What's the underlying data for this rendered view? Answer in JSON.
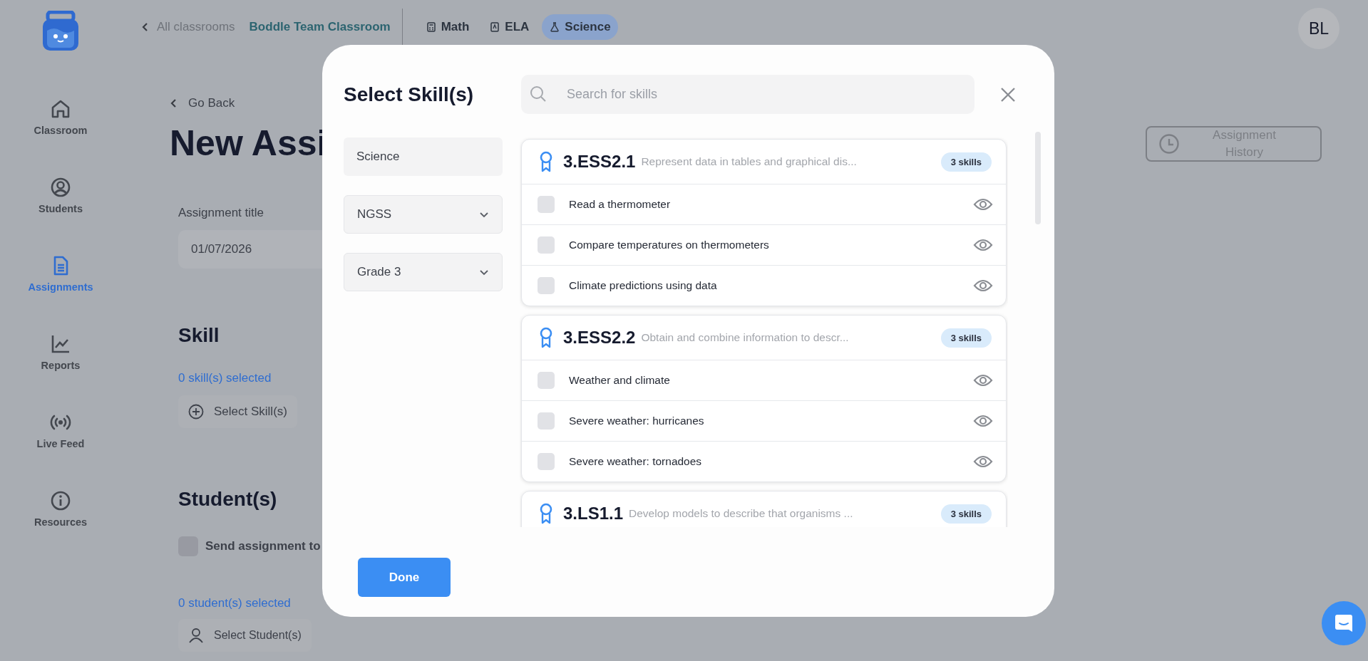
{
  "topbar": {
    "back_label": "All classrooms",
    "classroom": "Boddle Team Classroom",
    "subjects": [
      {
        "label": "Math",
        "selected": false
      },
      {
        "label": "ELA",
        "selected": false
      },
      {
        "label": "Science",
        "selected": true
      }
    ],
    "avatar": "BL"
  },
  "sidebar": {
    "items": [
      {
        "label": "Classroom",
        "selected": false
      },
      {
        "label": "Students",
        "selected": false
      },
      {
        "label": "Assignments",
        "selected": true
      },
      {
        "label": "Reports",
        "selected": false
      },
      {
        "label": "Live Feed",
        "selected": false
      },
      {
        "label": "Resources",
        "selected": false
      }
    ]
  },
  "page": {
    "back": "Go Back",
    "title": "New Assi",
    "history_button": "Assignment History",
    "title_field": {
      "label": "Assignment title",
      "value": "01/07/2026"
    },
    "skill": {
      "heading": "Skill",
      "count": "0 skill(s) selected",
      "button": "Select Skill(s)"
    },
    "students": {
      "heading": "Student(s)",
      "send_all": {
        "label": "Send assignment to",
        "checked": false
      },
      "count": "0 student(s) selected",
      "button": "Select Student(s)"
    }
  },
  "modal": {
    "title": "Select Skill(s)",
    "search_placeholder": "Search for skills",
    "filters": [
      {
        "kind": "static",
        "value": "Science"
      },
      {
        "kind": "dropdown",
        "value": "NGSS"
      },
      {
        "kind": "dropdown",
        "value": "Grade 3"
      }
    ],
    "groups": [
      {
        "code": "3.ESS2.1",
        "description": "Represent data in tables and graphical dis...",
        "count": "3 skills",
        "skills": [
          {
            "name": "Read a thermometer",
            "checked": false
          },
          {
            "name": "Compare temperatures on thermometers",
            "checked": false
          },
          {
            "name": "Climate predictions using data",
            "checked": false
          }
        ]
      },
      {
        "code": "3.ESS2.2",
        "description": "Obtain and combine information to descr...",
        "count": "3 skills",
        "skills": [
          {
            "name": "Weather and climate",
            "checked": false
          },
          {
            "name": "Severe weather: hurricanes",
            "checked": false
          },
          {
            "name": "Severe weather: tornadoes",
            "checked": false
          }
        ]
      },
      {
        "code": "3.LS1.1",
        "description": "Develop models to describe that organisms ...",
        "count": "3 skills"
      }
    ],
    "done": "Done"
  }
}
